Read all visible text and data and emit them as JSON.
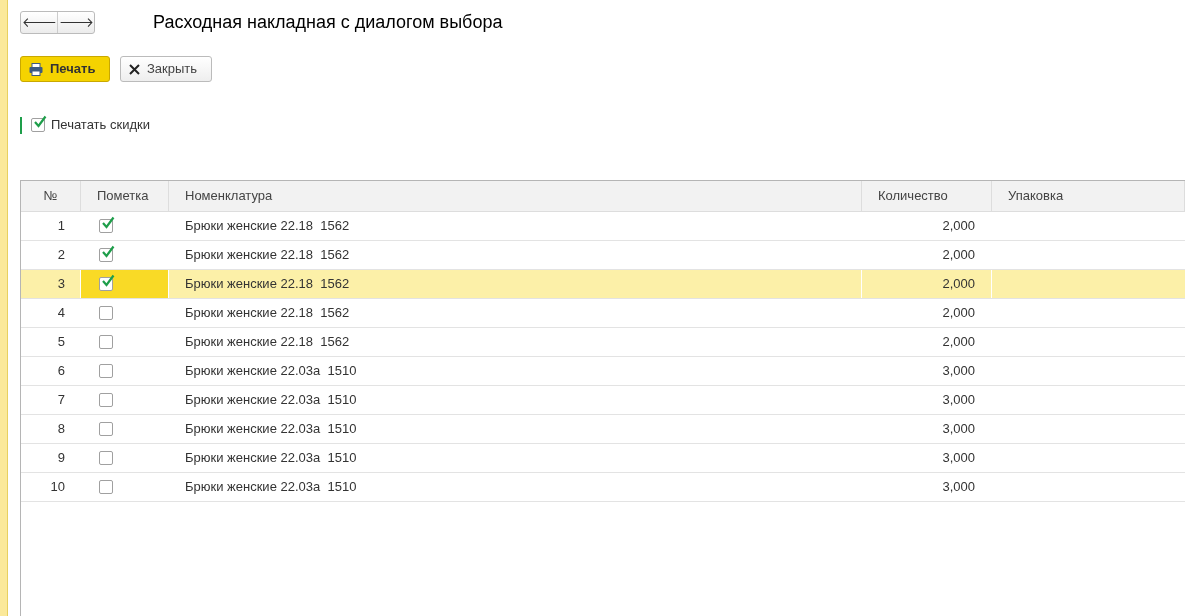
{
  "window": {
    "title": "Расходная накладная с диалогом выбора"
  },
  "nav": {
    "back": "🡐",
    "forward": "🡒"
  },
  "toolbar": [
    {
      "kind": "print",
      "label": "Печать"
    },
    {
      "kind": "close",
      "label": "Закрыть"
    }
  ],
  "print_discounts": {
    "label": "Печатать скидки",
    "checked": true
  },
  "table": {
    "columns": [
      "№",
      "Пометка",
      "Номенклатура",
      "Количество",
      "Упаковка"
    ],
    "rows": [
      {
        "n": "1",
        "checked": true,
        "item": "Брюки женские 22.18  1562",
        "qty": "2,000",
        "selected": false
      },
      {
        "n": "2",
        "checked": true,
        "item": "Брюки женские 22.18  1562",
        "qty": "2,000",
        "selected": false
      },
      {
        "n": "3",
        "checked": true,
        "item": "Брюки женские 22.18  1562",
        "qty": "2,000",
        "selected": true
      },
      {
        "n": "4",
        "checked": false,
        "item": "Брюки женские 22.18  1562",
        "qty": "2,000",
        "selected": false
      },
      {
        "n": "5",
        "checked": false,
        "item": "Брюки женские 22.18  1562",
        "qty": "2,000",
        "selected": false
      },
      {
        "n": "6",
        "checked": false,
        "item": "Брюки женские 22.03а  1510",
        "qty": "3,000",
        "selected": false
      },
      {
        "n": "7",
        "checked": false,
        "item": "Брюки женские 22.03а  1510",
        "qty": "3,000",
        "selected": false
      },
      {
        "n": "8",
        "checked": false,
        "item": "Брюки женские 22.03а  1510",
        "qty": "3,000",
        "selected": false
      },
      {
        "n": "9",
        "checked": false,
        "item": "Брюки женские 22.03а  1510",
        "qty": "3,000",
        "selected": false
      },
      {
        "n": "10",
        "checked": false,
        "item": "Брюки женские 22.03а  1510",
        "qty": "3,000",
        "selected": false
      }
    ]
  }
}
